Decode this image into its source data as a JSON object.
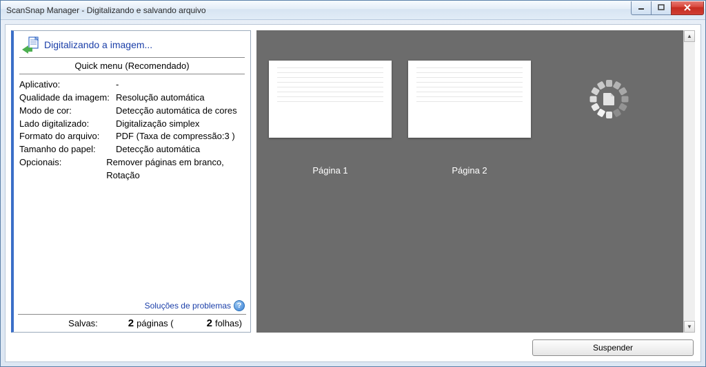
{
  "window": {
    "title": "ScanSnap Manager - Digitalizando e salvando arquivo"
  },
  "status": {
    "text": "Digitalizando a imagem..."
  },
  "menu_header": "Quick menu (Recomendado)",
  "settings": [
    {
      "label": "Aplicativo:",
      "value": "-"
    },
    {
      "label": "Qualidade da imagem:",
      "value": "Resolução automática"
    },
    {
      "label": "Modo de cor:",
      "value": "Detecção automática de cores"
    },
    {
      "label": "Lado digitalizado:",
      "value": "Digitalização simplex"
    },
    {
      "label": "Formato do arquivo:",
      "value": "PDF (Taxa de compressão:3 )"
    },
    {
      "label": "Tamanho do papel:",
      "value": "Detecção automática"
    },
    {
      "label": "Opcionais:",
      "value": "Remover páginas em branco, Rotação"
    }
  ],
  "troubleshoot_link": "Soluções de problemas",
  "saved": {
    "label": "Salvas:",
    "pages_count": "2",
    "pages_word": "páginas (",
    "sheets_count": "2",
    "sheets_word": "folhas)"
  },
  "pages": [
    {
      "label": "Página 1"
    },
    {
      "label": "Página 2"
    }
  ],
  "suspend_button": "Suspender"
}
